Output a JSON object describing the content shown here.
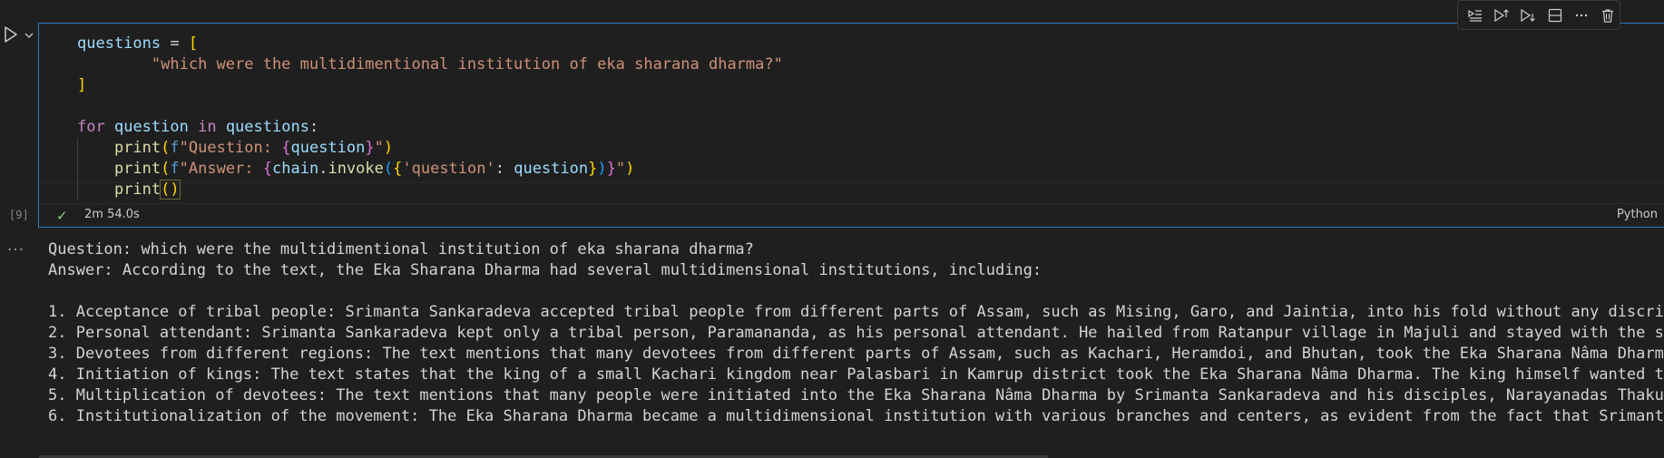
{
  "cell": {
    "execution_count": "[9]",
    "duration": "2m 54.0s",
    "language": "Python",
    "status_icon": "check-icon",
    "run_icon": "play-icon",
    "toolbar_icons": [
      "execute-above-icon",
      "execute-cell-and-above-icon",
      "execute-cell-and-below-icon",
      "split-cell-icon",
      "more-actions-icon",
      "delete-cell-icon"
    ]
  },
  "code": {
    "l1_var": "questions",
    "l1_eq": " = ",
    "l1_open": "[",
    "l2_indent": "        ",
    "l2_str": "\"which were the multidimentional institution of eka sharana dharma?\"",
    "l3_close": "]",
    "l5_for": "for",
    "l5_sp1": " ",
    "l5_var1": "question",
    "l5_in": " in ",
    "l5_var2": "questions",
    "l5_colon": ":",
    "l6_print": "print",
    "l6_open": "(",
    "l6_f": "f",
    "l6_str1": "\"Question: ",
    "l6_b_open": "{",
    "l6_var": "question",
    "l6_b_close": "}",
    "l6_str2": "\"",
    "l6_close": ")",
    "l7_print": "print",
    "l7_open": "(",
    "l7_f": "f",
    "l7_str1": "\"Answer: ",
    "l7_b_open": "{",
    "l7_chain": "chain",
    "l7_dot": ".",
    "l7_invoke": "invoke",
    "l7_p_open": "(",
    "l7_d_open": "{",
    "l7_key": "'question'",
    "l7_colon": ": ",
    "l7_val": "question",
    "l7_d_close": "}",
    "l7_p_close": ")",
    "l7_b_close": "}",
    "l7_str2": "\"",
    "l7_close": ")",
    "l8_print": "print",
    "l8_parens": "()"
  },
  "output": {
    "more_label": "...",
    "lines": [
      "Question: which were the multidimentional institution of eka sharana dharma?",
      "Answer: According to the text, the Eka Sharana Dharma had several multidimensional institutions, including:",
      "",
      "1. Acceptance of tribal people: Srimanta Sankaradeva accepted tribal people from different parts of Assam, such as Mising, Garo, and Jaintia, into his fold without any discrimi",
      "2. Personal attendant: Srimanta Sankaradeva kept only a tribal person, Paramananda, as his personal attendant. He hailed from Ratanpur village in Majuli and stayed with the sai",
      "3. Devotees from different regions: The text mentions that many devotees from different parts of Assam, such as Kachari, Heramdoi, and Bhutan, took the Eka Sharana Nâma Dharma",
      "4. Initiation of kings: The text states that the king of a small Kachari kingdom near Palasbari in Kamrup district took the Eka Sharana Nâma Dharma. The king himself wanted to",
      "5. Multiplication of devotees: The text mentions that many people were initiated into the Eka Sharana Nâma Dharma by Srimanta Sankaradeva and his disciples, Narayanadas Thakur",
      "6. Institutionalization of the movement: The Eka Sharana Dharma became a multidimensional institution with various branches and centers, as evident from the fact that Srimanta"
    ]
  },
  "colors": {
    "background": "#1f1f1f",
    "cell_border": "#2f7bc1",
    "breakpoint": "#e51400",
    "success": "#89d185"
  }
}
